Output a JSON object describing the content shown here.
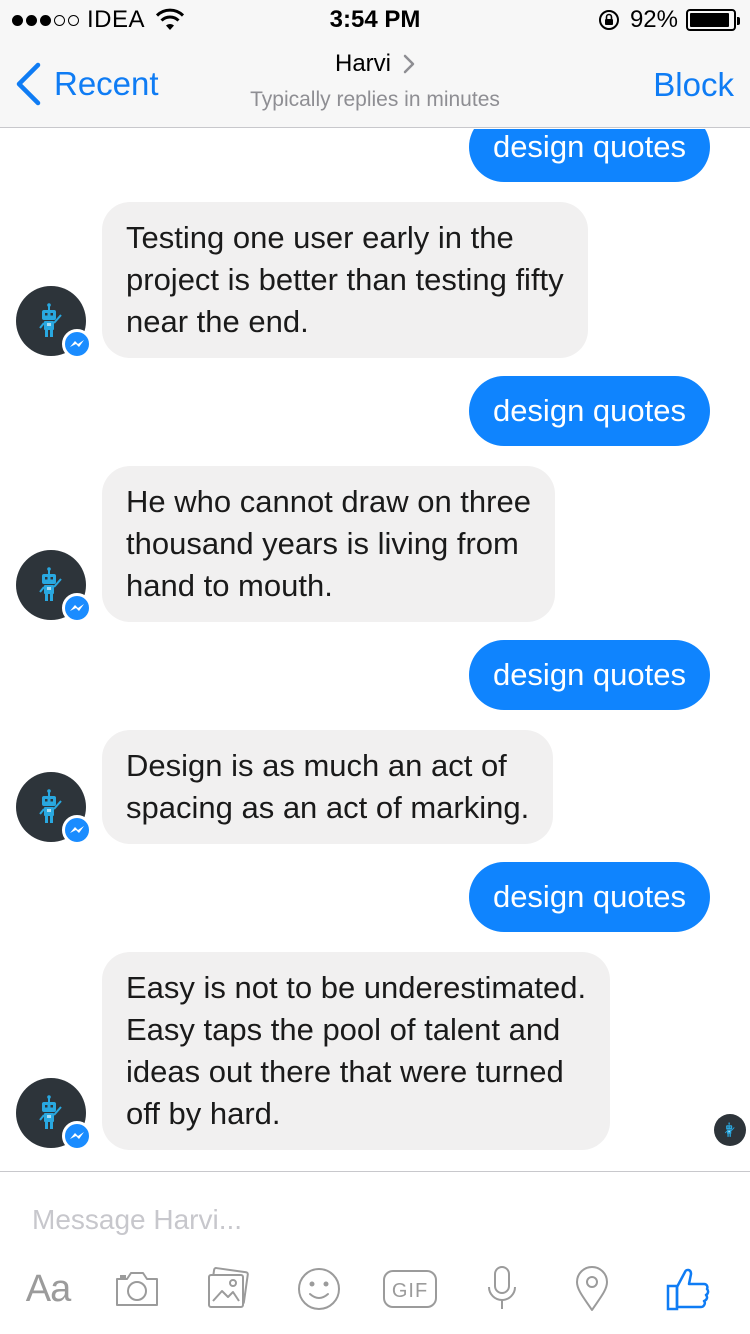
{
  "status_bar": {
    "carrier": "IDEA",
    "time": "3:54 PM",
    "battery": "92%",
    "battery_level": 0.92
  },
  "nav": {
    "back_label": "Recent",
    "contact_name": "Harvi",
    "subtitle": "Typically replies in minutes",
    "block_label": "Block"
  },
  "messages": [
    {
      "from": "me",
      "text": "design quotes"
    },
    {
      "from": "bot",
      "text": "Testing one user early in the\nproject is better than testing fifty\nnear the end."
    },
    {
      "from": "me",
      "text": "design quotes"
    },
    {
      "from": "bot",
      "text": "He who cannot draw on three\nthousand years is living from\nhand to mouth."
    },
    {
      "from": "me",
      "text": "design quotes"
    },
    {
      "from": "bot",
      "text": "Design is as much an act of\nspacing as an act of marking."
    },
    {
      "from": "me",
      "text": "design quotes"
    },
    {
      "from": "bot",
      "text": "Easy is not to be underestimated.\nEasy taps the pool of talent and\nideas out there that were turned\noff by hard."
    }
  ],
  "composer": {
    "placeholder": "Message Harvi...",
    "toolbar": [
      {
        "name": "text-format",
        "label": "Aa"
      },
      {
        "name": "camera-icon"
      },
      {
        "name": "photo-icon"
      },
      {
        "name": "emoji-icon"
      },
      {
        "name": "gif-icon",
        "label": "GIF"
      },
      {
        "name": "microphone-icon"
      },
      {
        "name": "location-icon"
      },
      {
        "name": "like-icon"
      }
    ]
  },
  "colors": {
    "accent": "#0f7cf4",
    "sent_bubble": "#0f84fe",
    "received_bubble": "#f1f0f0",
    "avatar_bg": "#2d343a",
    "robot": "#29a8e0",
    "icon_gray": "#9b9b9b"
  }
}
